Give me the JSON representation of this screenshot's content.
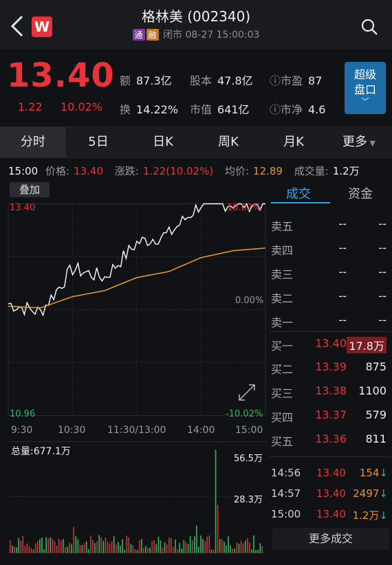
{
  "header": {
    "title": "格林美 (002340)",
    "tag_tong": "通",
    "tag_rong": "融",
    "status": "闭市 08-27 15:00:03",
    "logo": "W"
  },
  "quote": {
    "price": "13.40",
    "change": "1.22",
    "change_pct": "10.02%",
    "stats": [
      {
        "label": "额",
        "value": "87.3亿"
      },
      {
        "label": "股本",
        "value": "47.8亿"
      },
      {
        "label": "市盈",
        "value": "87"
      },
      {
        "label": "换",
        "value": "14.22%"
      },
      {
        "label": "市值",
        "value": "641亿"
      },
      {
        "label": "市净",
        "value": "4.6"
      }
    ],
    "super_button": [
      "超级",
      "盘口"
    ]
  },
  "tabs": [
    "分时",
    "5日",
    "日K",
    "周K",
    "月K",
    "更多"
  ],
  "info_line": {
    "time": "15:00",
    "price_label": "价格:",
    "price": "13.40",
    "change_label": "涨跌:",
    "change": "1.22(10.02%)",
    "avg_label": "均价:",
    "avg": "12.89",
    "vol_label": "成交量:",
    "vol": "1.2万"
  },
  "chart": {
    "overlay_button": "叠加",
    "y_top_left": "13.40",
    "y_top_right": "10.02%",
    "y_mid_right": "0.00%",
    "y_bottom_left": "10.96",
    "y_bottom_right": "-10.02%",
    "time_ticks": [
      "9:30",
      "10:30",
      "11:30/13:00",
      "14:00",
      "15:00"
    ],
    "total_vol_label": "总量:677.1万",
    "vol_top": "56.5万",
    "vol_mid": "28.3万",
    "colors": {
      "up": "#e8333a",
      "down": "#2bbd5d",
      "price_line": "#ffffff",
      "avg_line": "#e6962f"
    }
  },
  "chart_data": {
    "type": "line",
    "title": "",
    "xlabel": "",
    "ylabel": "",
    "ylim": [
      10.96,
      13.4
    ],
    "x": [
      "9:30",
      "10:00",
      "10:30",
      "11:00",
      "11:30/13:00",
      "13:30",
      "14:00",
      "14:30",
      "15:00"
    ],
    "series": [
      {
        "values": [
          12.25,
          12.15,
          12.65,
          12.55,
          12.95,
          13.05,
          13.4,
          13.4,
          13.4
        ]
      },
      {
        "values": [
          12.22,
          12.2,
          12.33,
          12.4,
          12.55,
          12.62,
          12.78,
          12.86,
          12.89
        ]
      }
    ]
  },
  "side": {
    "tab_trades": "成交",
    "tab_funds": "资金",
    "asks": [
      {
        "label": "卖五",
        "price": "--",
        "vol": "--"
      },
      {
        "label": "卖四",
        "price": "--",
        "vol": "--"
      },
      {
        "label": "卖三",
        "price": "--",
        "vol": "--"
      },
      {
        "label": "卖二",
        "price": "--",
        "vol": "--"
      },
      {
        "label": "卖一",
        "price": "--",
        "vol": "--"
      }
    ],
    "bids": [
      {
        "label": "买一",
        "price": "13.40",
        "vol": "17.8万"
      },
      {
        "label": "买二",
        "price": "13.39",
        "vol": "875"
      },
      {
        "label": "买三",
        "price": "13.38",
        "vol": "1100"
      },
      {
        "label": "买四",
        "price": "13.37",
        "vol": "579"
      },
      {
        "label": "买五",
        "price": "13.36",
        "vol": "811"
      }
    ],
    "trades": [
      {
        "time": "14:56",
        "price": "13.40",
        "vol": "154",
        "arrow": "↓"
      },
      {
        "time": "14:57",
        "price": "13.40",
        "vol": "2497",
        "arrow": "↓"
      },
      {
        "time": "15:00",
        "price": "13.40",
        "vol": "1.2万",
        "arrow": "↓"
      }
    ],
    "more": "更多成交"
  }
}
